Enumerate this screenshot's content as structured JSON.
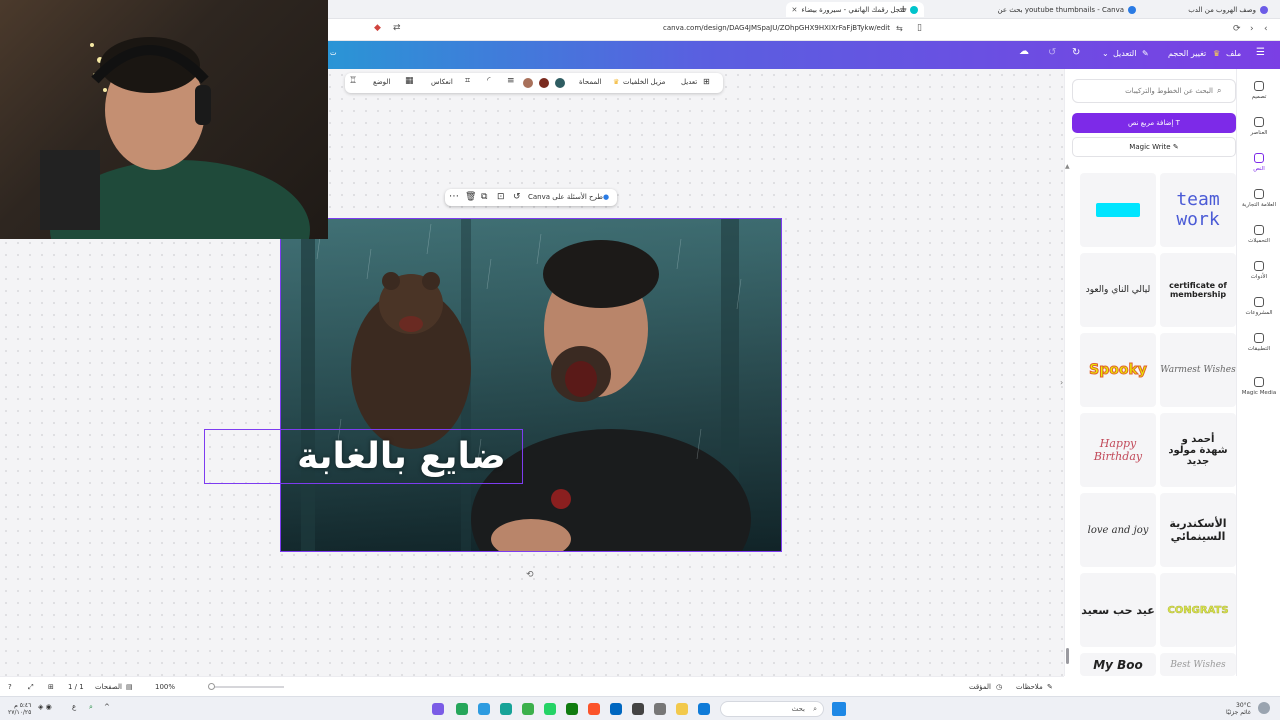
{
  "browser": {
    "tabs": [
      {
        "label": "وصف الهروب من الدب",
        "fav_color": "#6c5ce7"
      },
      {
        "label": "youtube thumbnails - Canva بحث عن",
        "fav_color": "#2a7be4"
      },
      {
        "label": "سجل رقمك الهاتفي - سيرورة بيضاء",
        "fav_color": "#00c4cc"
      }
    ],
    "new_tab": "+",
    "url": "canva.com/design/DAG4JMSpaJU/ZOhpGHX9HXIXrFaFjBTykw/edit"
  },
  "header": {
    "menu_icon": "hamburger-icon",
    "file_label": "ملف",
    "resize_label": "تغيير الحجم",
    "edit_label": "التعديل",
    "undo_icon": "undo-icon",
    "redo_icon": "redo-icon",
    "cloud_icon": "cloud-icon"
  },
  "toolbar": {
    "edit_label": "تعديل",
    "bg_remover_label": "مزيل الخلفيات",
    "eraser_label": "الممحاة",
    "flip_label": "انعكاس",
    "position_label": "الوضع",
    "swatches": [
      "#2f5d62",
      "#7a2a1e",
      "#a8705a"
    ]
  },
  "floatbar": {
    "ask_label": "طرح الأسئلة على Canva",
    "more_icon": "more-icon"
  },
  "canvas": {
    "title_text": "ضايع بالغابة"
  },
  "panel": {
    "search_placeholder": "البحث عن الخطوط والتركيبات",
    "add_textbox_label": "إضافة مربع نص",
    "magic_write_label": "Magic Write",
    "cards": [
      {
        "text": "team work",
        "color": "#4b5bd6"
      },
      {
        "text": "",
        "color": "#00e5ff"
      },
      {
        "text": "certificate of membership",
        "color": "#222222"
      },
      {
        "text": "ليالي الناي والعود",
        "color": "#222222"
      },
      {
        "text": "Warmest Wishes",
        "color": "#666666"
      },
      {
        "text": "Spooky",
        "color": "#e8f000"
      },
      {
        "text": "أحمد و شهدة مولود جديد",
        "color": "#222222"
      },
      {
        "text": "Happy Birthday",
        "color": "#c24a5a"
      },
      {
        "text": "الأسكندرية السينمائي",
        "color": "#222222"
      },
      {
        "text": "love and joy",
        "color": "#333333"
      },
      {
        "text": "CONGRATS",
        "color": "#d9e84a"
      },
      {
        "text": "عيد حب سعيد",
        "color": "#222222"
      },
      {
        "text": "Best Wishes",
        "color": "#999999"
      },
      {
        "text": "My Boo",
        "color": "#222222"
      }
    ]
  },
  "rail": {
    "items": [
      {
        "label": "تصميم",
        "icon": "design-icon"
      },
      {
        "label": "العناصر",
        "icon": "elements-icon"
      },
      {
        "label": "النص",
        "icon": "text-icon"
      },
      {
        "label": "العلامة التجارية",
        "icon": "brand-icon"
      },
      {
        "label": "التحميلات",
        "icon": "uploads-icon"
      },
      {
        "label": "الأدوات",
        "icon": "tools-icon"
      },
      {
        "label": "المشروعات",
        "icon": "projects-icon"
      },
      {
        "label": "التطبيقات",
        "icon": "apps-icon"
      },
      {
        "label": "Magic Media",
        "icon": "magic-media-icon"
      }
    ]
  },
  "bottombar": {
    "notes_label": "ملاحظات",
    "timer_label": "المؤقت",
    "zoom": "100%",
    "pages_label": "الصفحات",
    "page_count": "1 / 1"
  },
  "taskbar": {
    "search_label": "بحث",
    "weather_temp": "30°C",
    "weather_desc": "غائم جزئيًا",
    "time": "٥:٤٦ م",
    "date": "٢٧/١٠/٢٥"
  }
}
